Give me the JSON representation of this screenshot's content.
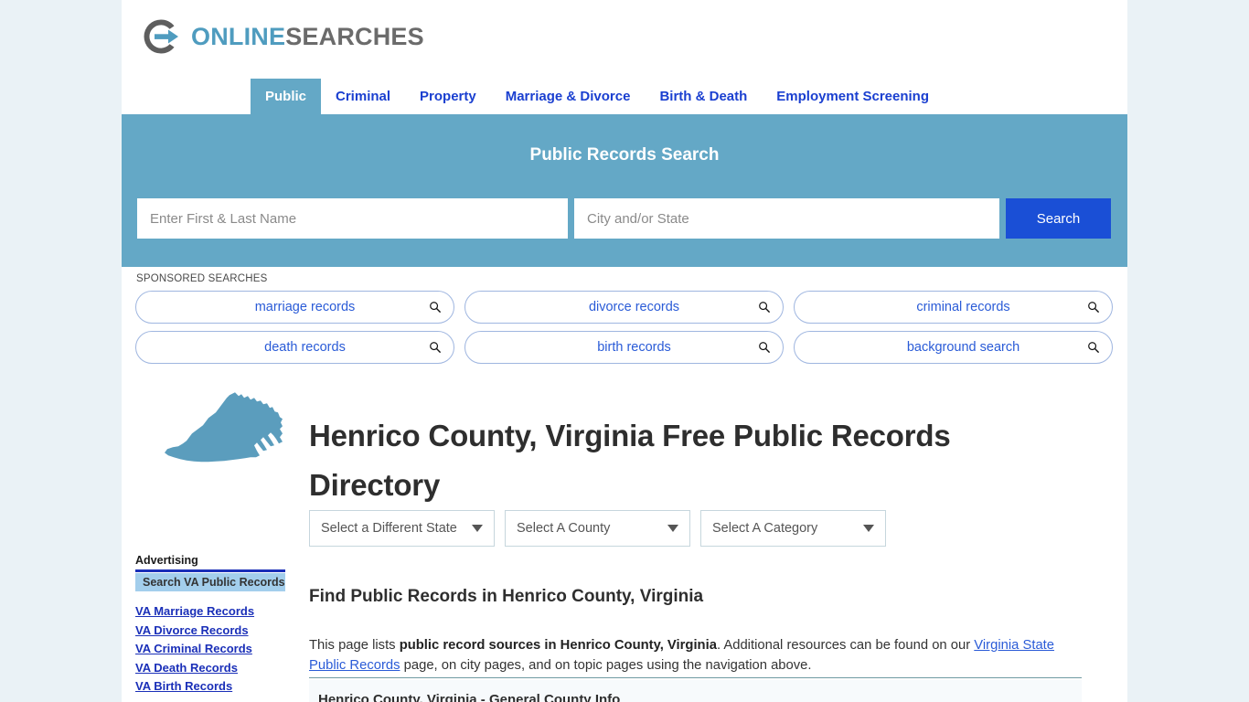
{
  "brand": {
    "name_part1": "ONLINE",
    "name_part2": "SEARCHES",
    "icon": "circle-arrow-logo",
    "accent_color": "#4f9cbf",
    "secondary_color": "#6b6b6b"
  },
  "nav": {
    "tabs": [
      {
        "label": "Public",
        "active": true
      },
      {
        "label": "Criminal",
        "active": false
      },
      {
        "label": "Property",
        "active": false
      },
      {
        "label": "Marriage & Divorce",
        "active": false
      },
      {
        "label": "Birth & Death",
        "active": false
      },
      {
        "label": "Employment Screening",
        "active": false
      }
    ]
  },
  "hero": {
    "title": "Public Records Search",
    "background_color": "#64a8c6",
    "name_placeholder": "Enter First & Last Name",
    "name_value": "",
    "city_placeholder": "City and/or State",
    "city_value": "",
    "search_button": "Search",
    "search_button_color": "#1a4fd6"
  },
  "sponsored": {
    "label": "SPONSORED SEARCHES",
    "pills": [
      {
        "label": "marriage records",
        "icon": "search-icon"
      },
      {
        "label": "divorce records",
        "icon": "search-icon"
      },
      {
        "label": "criminal records",
        "icon": "search-icon"
      },
      {
        "label": "death records",
        "icon": "search-icon"
      },
      {
        "label": "birth records",
        "icon": "search-icon"
      },
      {
        "label": "background search",
        "icon": "search-icon"
      }
    ]
  },
  "main": {
    "state_map_icon": "virginia-state-outline",
    "state_map_color": "#5b9dbd",
    "page_title": "Henrico County, Virginia Free Public Records Directory",
    "selects": [
      {
        "value": "Select a Different State"
      },
      {
        "value": "Select A County"
      },
      {
        "value": "Select A Category"
      }
    ],
    "section_heading": "Find Public Records in Henrico County, Virginia",
    "paragraph": {
      "lead": "This page lists ",
      "bold": "public record sources in Henrico County, Virginia",
      "middle": ". Additional resources can be found on our ",
      "link": "Virginia State Public Records",
      "tail": " page, on city pages, and on topic pages using the navigation above."
    },
    "table_heading": "Henrico County, Virginia - General County Info"
  },
  "sidebar": {
    "ad_title": "Advertising",
    "ad_box_label": "Search VA Public Records",
    "links": [
      "VA Marriage Records",
      "VA Divorce Records",
      "VA Criminal Records",
      "VA Death Records",
      "VA Birth Records"
    ]
  }
}
